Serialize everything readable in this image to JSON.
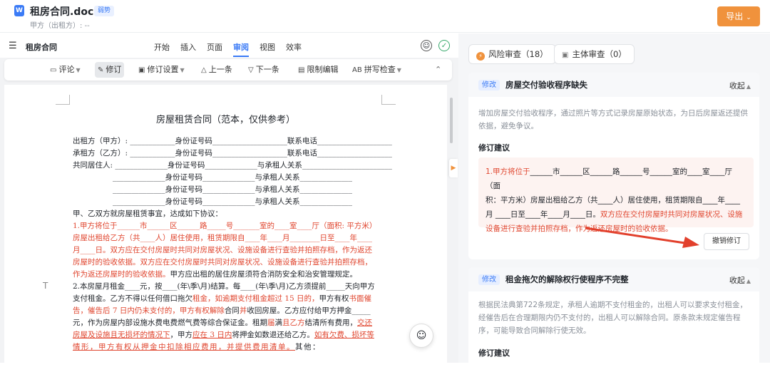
{
  "app": {
    "doc_icon": "W",
    "doc_title": "租房合同.doc",
    "tag": "弱势",
    "subtitle": "甲方（出租方）: --",
    "export_label": "导出",
    "brand_color": "#f0923c",
    "accent_color": "#3b7bf6"
  },
  "menubar": {
    "doc_name": "租房合同",
    "tabs": [
      "开始",
      "插入",
      "页面",
      "审阅",
      "视图",
      "效率"
    ],
    "active_tab": "审阅"
  },
  "toolbar": {
    "comment": "评论",
    "track": "修订",
    "track_settings": "修订设置",
    "prev": "上一条",
    "next": "下一条",
    "restrict": "限制编辑",
    "spell": "拼写检查",
    "spell_icon_text": "AB"
  },
  "document": {
    "title": "房屋租赁合同（范本，仅供参考）",
    "lines": [
      "出租方（甲方）: ____________身份证号码____________________联系电话____________________",
      "承租方（乙方）: ____________身份证号码____________________联系电话____________________",
      "共同居住人: ______________身份证号码______________与承租人关系________________________",
      "______________身份证号码______________与承租人关系______________",
      "______________身份证号码______________与承租人关系______________",
      "______________身份证号码______________与承租人关系______________",
      "甲、乙双方就房屋租赁事宜，达成如下协议："
    ],
    "clause1": [
      "1.甲方将位于______市______区______路_____号_______室的____室____厅（面积:     平方米）",
      "房屋出租给乙方（共____人）居住使用，租赁期限自____年____月________日至____年____",
      "月____日。双方应在交付房屋时共同对房屋状况、设施设备进行查验并拍照存档，作为返还",
      "房屋时的验收依据。双方应在交付房屋时共同对房屋状况、设施设备进行查验并拍照存档，",
      "作为返还房屋时的验收依据。"
    ],
    "clause1_tail": "甲方应出租的居住房屋须符合消防安全和治安管理规定。",
    "clause2": {
      "l1": "2.本房屋月租金____元，按____(年\\季\\月)结算。每____(年\\季\\月)乙方须提前_____天向甲方",
      "l2a": "支付租金。乙方不得以任何借口拖欠",
      "l2b": "租金",
      "l2c": "，如逾期支付租金超过 15 日的，",
      "l2d": "甲方有权",
      "l2e": "书面催",
      "l3a": "告，催告后 7 日内仍未支付的，甲方有权解除",
      "l3b": "合同",
      "l3c": "并",
      "l3d": "收回房屋。乙方应付给甲方押金_____",
      "l4a": "元，作为房屋内部设施水费电费燃气费等综合保证金。租期",
      "l4b": "届",
      "l4c": "满",
      "l4d": "且乙方",
      "l4e": "结清所有费用，",
      "l4f": "交还",
      "l5a": "房屋及设施且无损坏的情况下",
      "l5b": "，甲方",
      "l5c": "应在 3 日内",
      "l5d": "将押金如数退还给乙方。",
      "l5e": "如有欠费、损坏等",
      "l6a": "情形，甲方有权从押金中扣除相应费用，并提供费用清单。",
      "l6b": "其他："
    }
  },
  "review": {
    "tab_risk": "风险审查（18）",
    "tab_subject": "主体审查（0）",
    "cards": [
      {
        "badge": "修改",
        "title": "房屋交付验收程序缺失",
        "fold": "收起",
        "desc": "增加房屋交付验收程序，通过照片等方式记录房屋原始状态，为日后房屋返还提供依据，避免争议。",
        "suggestion_label": "修订建议",
        "suggestion_l1a": "1.甲方将位于",
        "suggestion_l1b": "______市______区______路______号______室的____室____厅（面",
        "suggestion_l2": "积：平方米）房屋出租给乙方（共____人）居住使用，租赁期限自____年____",
        "suggestion_l3a": "月 ____日至____年____月____日。",
        "suggestion_l3b": "双方应在交付房屋时共同对房屋状况、设施",
        "suggestion_l4": "设备进行查验并拍照存档，作为返还房屋时的验收依据。",
        "revoke": "撤销修订"
      },
      {
        "badge": "修改",
        "title": "租金拖欠的解除权行使程序不完整",
        "fold": "收起",
        "desc": "根据民法典第722条规定，承租人逾期不支付租金的，出租人可以要求支付租金，经催告后在合理期限内仍不支付的，出租人可以解除合同。原条款未规定催告程序，可能导致合同解除行使无效。",
        "suggestion_label": "修订建议"
      }
    ]
  }
}
